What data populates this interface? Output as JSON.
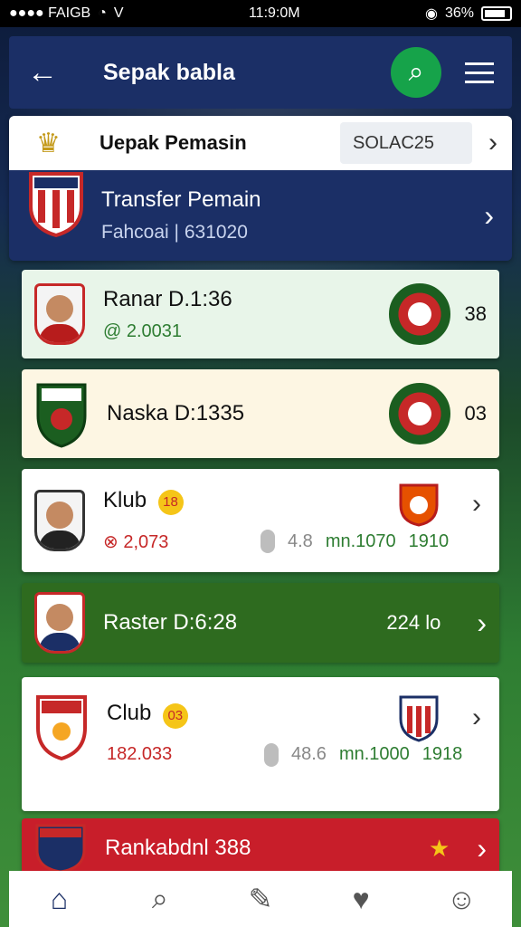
{
  "status_bar": {
    "carrier": "●●●● FAIGB",
    "signal_mark": "V",
    "time": "11:9:0M",
    "battery": "36%"
  },
  "header": {
    "title": "Sepak babla",
    "back_icon": "arrow-left-icon",
    "search_icon": "search-icon",
    "menu_icon": "hamburger-menu-icon"
  },
  "top_panel": {
    "title": "Uepak Pemasin",
    "input_value": "SOLAC25",
    "transfer_title": "Transfer Pemain",
    "transfer_sub": "Fahcoai | 631020"
  },
  "list": [
    {
      "title": "Ranar D.1:36",
      "sub": "@ 2.0031",
      "right": "38"
    },
    {
      "title": "Naska D:1335",
      "right": "03"
    },
    {
      "title": "Klub",
      "badge": "18",
      "stat_red": "⊗ 2,073",
      "stat_grey": "4.8",
      "stat_green": "mn.1070",
      "stat_right": "1910"
    },
    {
      "title": "Raster D:6:28",
      "right": "224 lo"
    },
    {
      "title": "Club",
      "badge": "03",
      "stat_red": "182.033",
      "stat_grey": "48.6",
      "stat_green": "mn.1000",
      "stat_right": "1918"
    },
    {
      "title": "Rankabdnl 388",
      "right_icon": "star-icon"
    }
  ],
  "bottom_nav": [
    "home-icon",
    "search-icon",
    "edit-icon",
    "favorite-icon",
    "profile-icon"
  ],
  "colors": {
    "header_bg": "#1b2f66",
    "accent_green": "#16a34a",
    "red": "#c81e2a",
    "dark_green": "#2e6b1f"
  }
}
